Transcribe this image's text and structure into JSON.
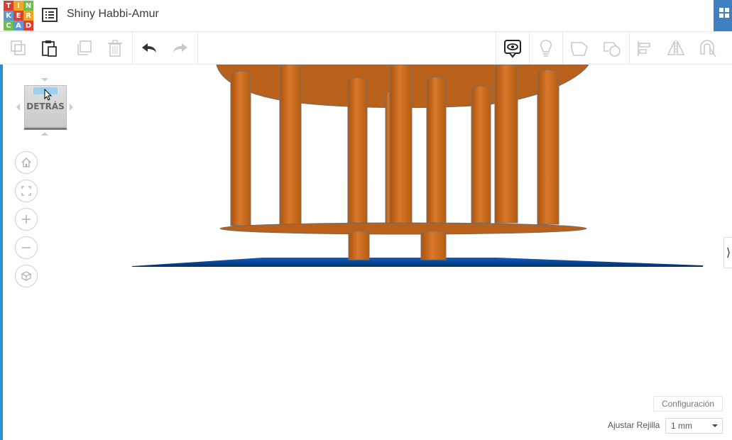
{
  "app": {
    "logo_letters": [
      "T",
      "I",
      "N",
      "K",
      "E",
      "R",
      "C",
      "A",
      "D"
    ],
    "logo_colors": [
      "#e03c31",
      "#f4a51c",
      "#6cbf4b",
      "#5b9bd5",
      "#e03c31",
      "#f4a51c",
      "#6cbf4b",
      "#5b9bd5",
      "#e03c31"
    ],
    "design_title": "Shiny Habbi-Amur"
  },
  "toolbar": {
    "buttons": [
      {
        "icon": "copy-icon",
        "enabled": false
      },
      {
        "icon": "paste-icon",
        "enabled": true
      },
      {
        "icon": "duplicate-icon",
        "enabled": false
      },
      {
        "icon": "delete-icon",
        "enabled": false
      },
      {
        "icon": "undo-icon",
        "enabled": true
      },
      {
        "icon": "redo-icon",
        "enabled": false
      },
      {
        "icon": "notes-visibility-icon",
        "enabled": true
      },
      {
        "icon": "lightbulb-icon",
        "enabled": false
      },
      {
        "icon": "group-icon",
        "enabled": false
      },
      {
        "icon": "ungroup-icon",
        "enabled": false
      },
      {
        "icon": "align-icon",
        "enabled": false
      },
      {
        "icon": "mirror-icon",
        "enabled": false
      },
      {
        "icon": "magnet-icon",
        "enabled": false
      }
    ]
  },
  "viewcube": {
    "label": "DETRÁS"
  },
  "nav_controls": [
    "home-view-icon",
    "fit-view-icon",
    "zoom-in-icon",
    "zoom-out-icon",
    "perspective-icon"
  ],
  "footer": {
    "settings_label": "Configuración",
    "snap_grid_label": "Ajustar Rejilla",
    "snap_grid_value": "1 mm"
  },
  "colors": {
    "wood": "#c96a1a",
    "workplane": "#0a4a9a",
    "accent": "#2b8fd6"
  }
}
